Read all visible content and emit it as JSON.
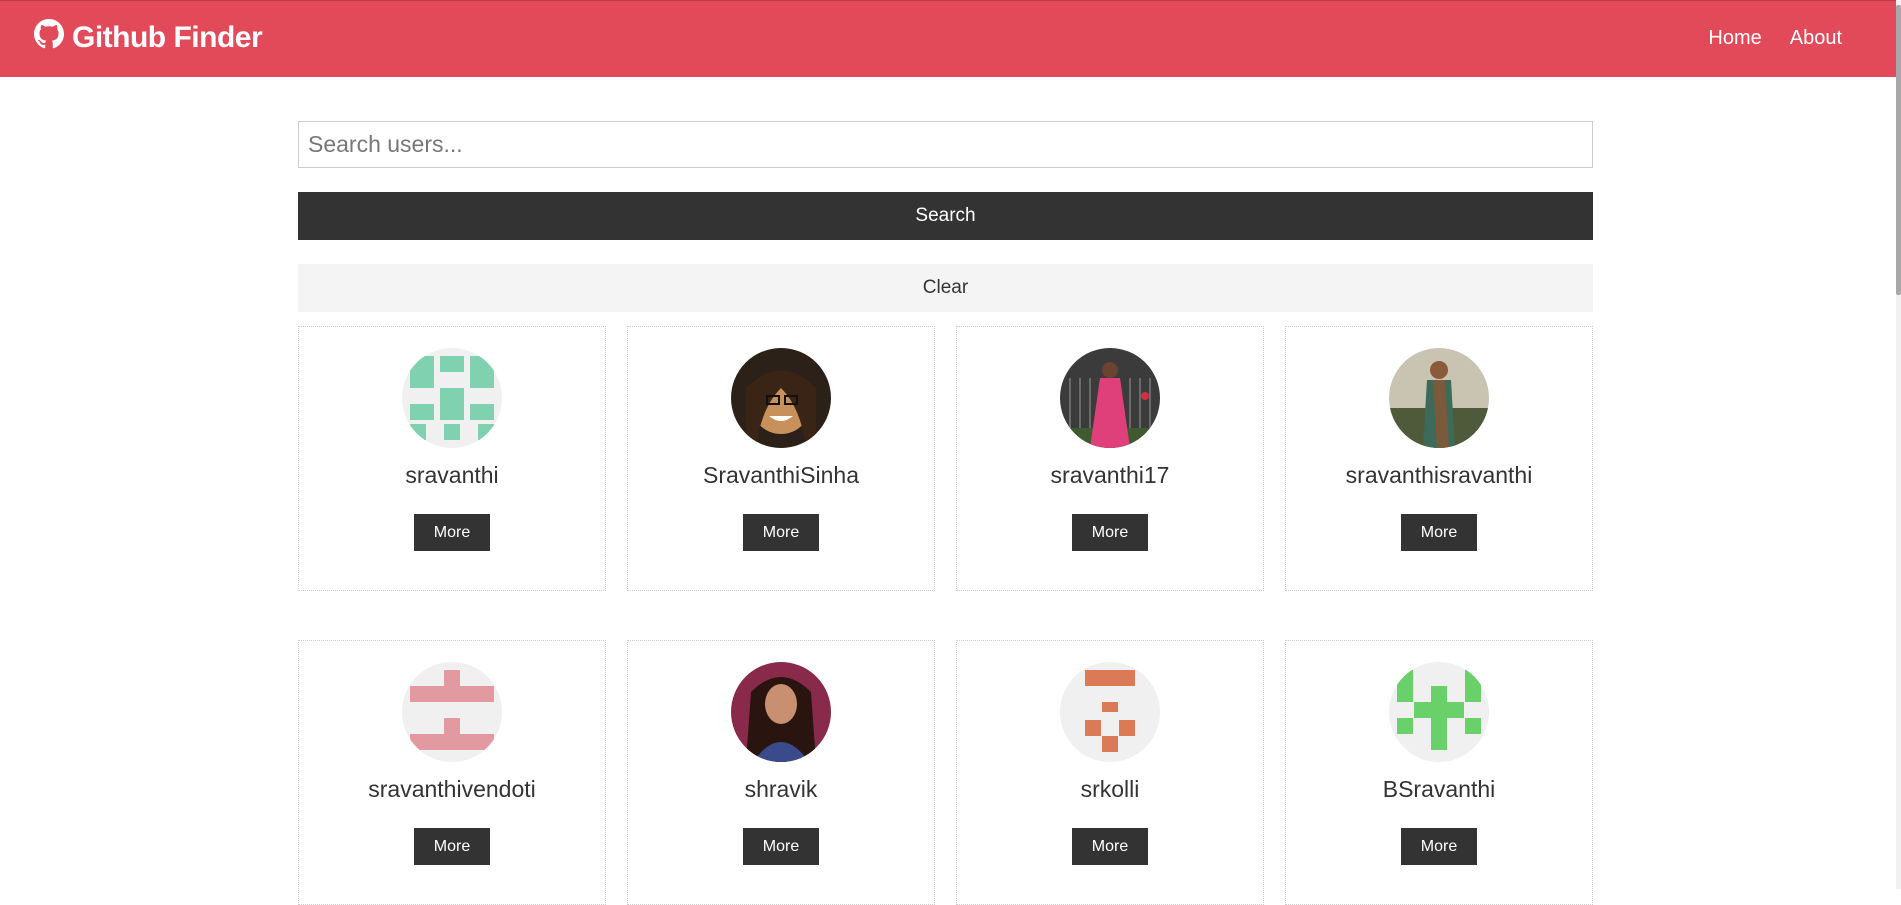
{
  "app": {
    "brand": "Github Finder",
    "brand_color": "#e24a5a"
  },
  "nav": {
    "home": "Home",
    "about": "About"
  },
  "search": {
    "placeholder": "Search users...",
    "value": "",
    "search_label": "Search",
    "clear_label": "Clear"
  },
  "users": [
    {
      "login": "sravanthi",
      "more_label": "More",
      "avatar": "identicon-teal"
    },
    {
      "login": "SravanthiSinha",
      "more_label": "More",
      "avatar": "photo"
    },
    {
      "login": "sravanthi17",
      "more_label": "More",
      "avatar": "photo"
    },
    {
      "login": "sravanthisravanthi",
      "more_label": "More",
      "avatar": "photo"
    },
    {
      "login": "sravanthivendoti",
      "more_label": "More",
      "avatar": "identicon-pink"
    },
    {
      "login": "shravik",
      "more_label": "More",
      "avatar": "photo"
    },
    {
      "login": "srkolli",
      "more_label": "More",
      "avatar": "identicon-orange"
    },
    {
      "login": "BSravanthi",
      "more_label": "More",
      "avatar": "identicon-green"
    }
  ]
}
